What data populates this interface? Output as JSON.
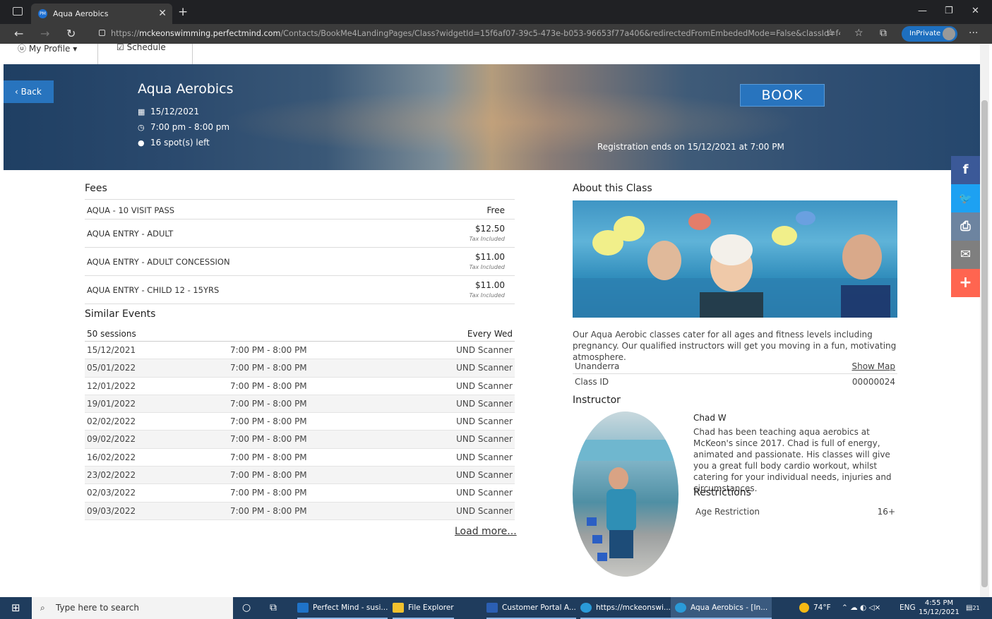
{
  "browser": {
    "tab_title": "Aqua Aerobics",
    "tab_favicon_text": "PM",
    "url_prefix": "https://",
    "url_host": "mckeonswimming.perfectmind.com",
    "url_path": "/Contacts/BookMe4LandingPages/Class?widgetId=15f6af07-39c5-473e-b053-96653f77a406&redirectedFromEmbededMode=False&classId=f4eedb0...",
    "inprivate_label": "InPrivate"
  },
  "topnav": {
    "my_profile": "My Profile ▾",
    "schedule": "Schedule"
  },
  "hero": {
    "back_label": "Back",
    "title": "Aqua Aerobics",
    "date": "15/12/2021",
    "time": "7:00 pm - 8:00 pm",
    "spots": "16 spot(s) left",
    "book_label": "BOOK",
    "registration_note": "Registration ends on 15/12/2021 at 7:00 PM"
  },
  "fees": {
    "heading": "Fees",
    "items": [
      {
        "name": "AQUA - 10 VISIT PASS",
        "price": "Free",
        "tax": ""
      },
      {
        "name": "AQUA ENTRY - ADULT",
        "price": "$12.50",
        "tax": "Tax Included"
      },
      {
        "name": "AQUA ENTRY - ADULT CONCESSION",
        "price": "$11.00",
        "tax": "Tax Included"
      },
      {
        "name": "AQUA ENTRY - CHILD 12 - 15YRS",
        "price": "$11.00",
        "tax": "Tax Included"
      }
    ]
  },
  "events": {
    "heading": "Similar Events",
    "sessions": "50 sessions",
    "frequency": "Every Wed",
    "rows": [
      {
        "date": "15/12/2021",
        "time": "7:00 PM - 8:00 PM",
        "resource": "UND Scanner"
      },
      {
        "date": "05/01/2022",
        "time": "7:00 PM - 8:00 PM",
        "resource": "UND Scanner"
      },
      {
        "date": "12/01/2022",
        "time": "7:00 PM - 8:00 PM",
        "resource": "UND Scanner"
      },
      {
        "date": "19/01/2022",
        "time": "7:00 PM - 8:00 PM",
        "resource": "UND Scanner"
      },
      {
        "date": "02/02/2022",
        "time": "7:00 PM - 8:00 PM",
        "resource": "UND Scanner"
      },
      {
        "date": "09/02/2022",
        "time": "7:00 PM - 8:00 PM",
        "resource": "UND Scanner"
      },
      {
        "date": "16/02/2022",
        "time": "7:00 PM - 8:00 PM",
        "resource": "UND Scanner"
      },
      {
        "date": "23/02/2022",
        "time": "7:00 PM - 8:00 PM",
        "resource": "UND Scanner"
      },
      {
        "date": "02/03/2022",
        "time": "7:00 PM - 8:00 PM",
        "resource": "UND Scanner"
      },
      {
        "date": "09/03/2022",
        "time": "7:00 PM - 8:00 PM",
        "resource": "UND Scanner"
      }
    ],
    "load_more": "Load more..."
  },
  "about": {
    "heading": "About this Class",
    "description": "Our Aqua Aerobic classes cater for all ages and fitness levels including pregnancy. Our qualified instructors will get you moving in a fun, motivating atmosphere.",
    "location": "Unanderra",
    "show_map": "Show Map",
    "class_id_label": "Class ID",
    "class_id": "00000024"
  },
  "instructor": {
    "heading": "Instructor",
    "name": "Chad W",
    "bio": "Chad has been teaching aqua aerobics at McKeon's since 2017. Chad is full of energy, animated and passionate. His classes will give you a great full body cardio workout, whilst catering for your individual needs, injuries and circumstances."
  },
  "restrictions": {
    "heading": "Restrictions",
    "label": "Age Restriction",
    "value": "16+"
  },
  "social": {
    "facebook": "f",
    "twitter": "🐦",
    "print": "⎙",
    "email": "✉",
    "more": "+"
  },
  "taskbar": {
    "search_placeholder": "Type here to search",
    "apps": [
      "Perfect Mind - susi...",
      "File Explorer",
      "Customer Portal A...",
      "https://mckeonswi...",
      "Aqua Aerobics - [In..."
    ],
    "weather": "74°F",
    "lang": "ENG",
    "time": "4:55 PM",
    "date": "15/12/2021",
    "notifications": "21"
  },
  "colors": {
    "accent": "#2874be",
    "facebook": "#3b5998",
    "twitter": "#1da1f2",
    "print": "#6d84a0",
    "email": "#7f7f7f",
    "more": "#ff6550"
  }
}
